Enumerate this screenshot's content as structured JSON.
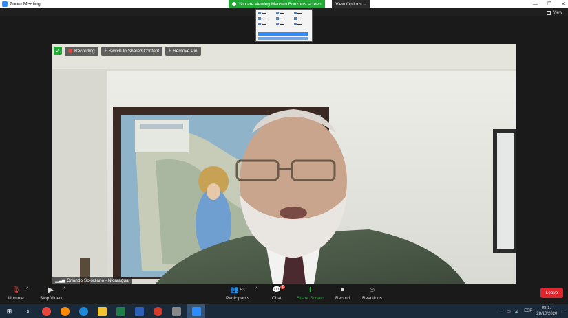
{
  "titlebar": {
    "title": "Zoom Meeting",
    "minimize": "—",
    "maximize": "❐",
    "close": "✕"
  },
  "banner": {
    "text": "You are viewing Marcelo Bonzon's screen"
  },
  "view_options": {
    "label": "View Options ⌄"
  },
  "view": {
    "label": "View"
  },
  "video_controls": {
    "recording": "Recording",
    "switch_shared": "Switch to Shared Content",
    "remove_pin": "Remove Pin"
  },
  "participant": {
    "name": "Orlando Solórzano - Nicaragua"
  },
  "toolbar": {
    "unmute": "Unmute",
    "stop_video": "Stop Video",
    "participants": "Participants",
    "participants_count": "53",
    "chat": "Chat",
    "chat_badge": "2",
    "share_screen": "Share Screen",
    "record": "Record",
    "reactions": "Reactions",
    "leave": "Leave"
  },
  "taskbar": {
    "lang": "ESP",
    "time": "08:17",
    "date": "28/10/2020"
  },
  "colors": {
    "zoom_green": "#23a836",
    "leave_red": "#e0262c",
    "zoom_blue": "#2d8cff"
  }
}
